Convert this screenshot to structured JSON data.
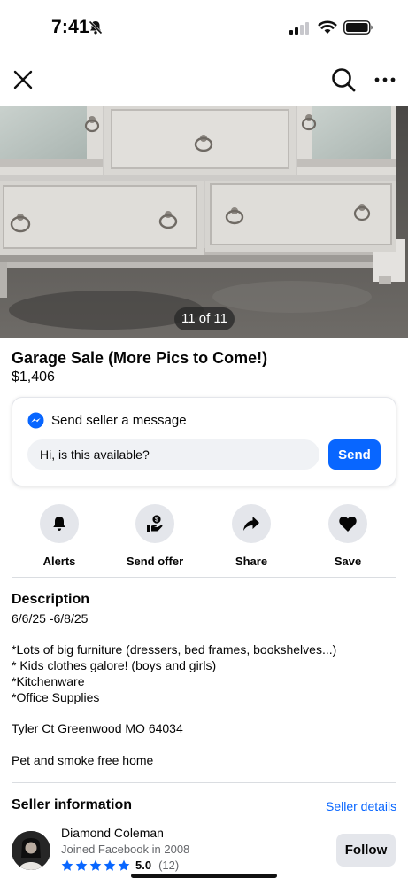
{
  "status_bar": {
    "time": "7:41"
  },
  "photo": {
    "counter": "11 of 11"
  },
  "listing": {
    "title": "Garage Sale (More Pics to Come!)",
    "price": "$1,406"
  },
  "message": {
    "heading": "Send seller a message",
    "input_value": "Hi, is this available?",
    "send_label": "Send"
  },
  "actions": [
    {
      "label": "Alerts",
      "icon": "bell-icon"
    },
    {
      "label": "Send offer",
      "icon": "hand-offer-icon"
    },
    {
      "label": "Share",
      "icon": "share-arrow-icon"
    },
    {
      "label": "Save",
      "icon": "heart-icon"
    }
  ],
  "description": {
    "heading": "Description",
    "lines": [
      "6/6/25 -6/8/25",
      "",
      "*Lots of big furniture (dressers, bed frames, bookshelves...)",
      "* Kids clothes galore! (boys and girls)",
      "*Kitchenware",
      "*Office Supplies",
      "",
      "Tyler Ct Greenwood MO 64034",
      "",
      "Pet and smoke free home"
    ]
  },
  "seller": {
    "heading": "Seller information",
    "details_link": "Seller details",
    "name": "Diamond Coleman",
    "joined": "Joined Facebook in 2008",
    "rating": "5.0",
    "rating_count": "(12)",
    "stars": 5,
    "follow_label": "Follow"
  },
  "colors": {
    "accent": "#0866ff",
    "button_gray": "#e4e6eb",
    "secondary_text": "#65676b"
  }
}
